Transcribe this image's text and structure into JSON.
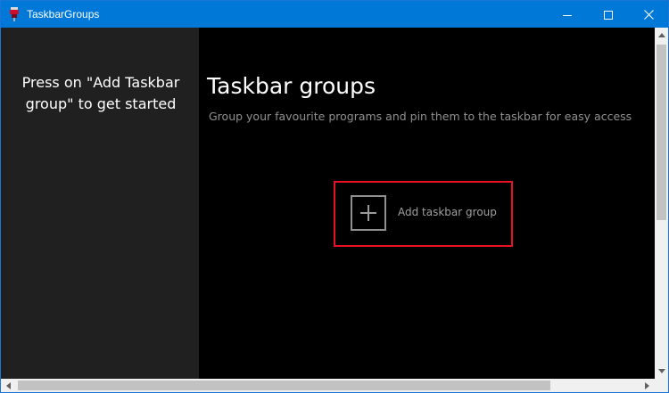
{
  "window": {
    "title": "TaskbarGroups",
    "app_icon": "taskbar-groups-app-icon",
    "controls": {
      "minimize_icon": "minimize-icon",
      "maximize_icon": "maximize-icon",
      "close_icon": "close-icon"
    },
    "accent_color": "#0078d7"
  },
  "sidebar": {
    "hint": "Press on \"Add Taskbar group\" to get started"
  },
  "main": {
    "title": "Taskbar groups",
    "subtitle": "Group your favourite programs and pin them to the taskbar for easy access",
    "add_button": {
      "label": "Add taskbar group",
      "icon": "plus-icon",
      "highlight_color": "#e81123"
    }
  },
  "scrollbars": {
    "vertical_icons": [
      "arrow-up-icon",
      "arrow-down-icon"
    ],
    "horizontal_icons": [
      "arrow-left-icon",
      "arrow-right-icon"
    ]
  }
}
